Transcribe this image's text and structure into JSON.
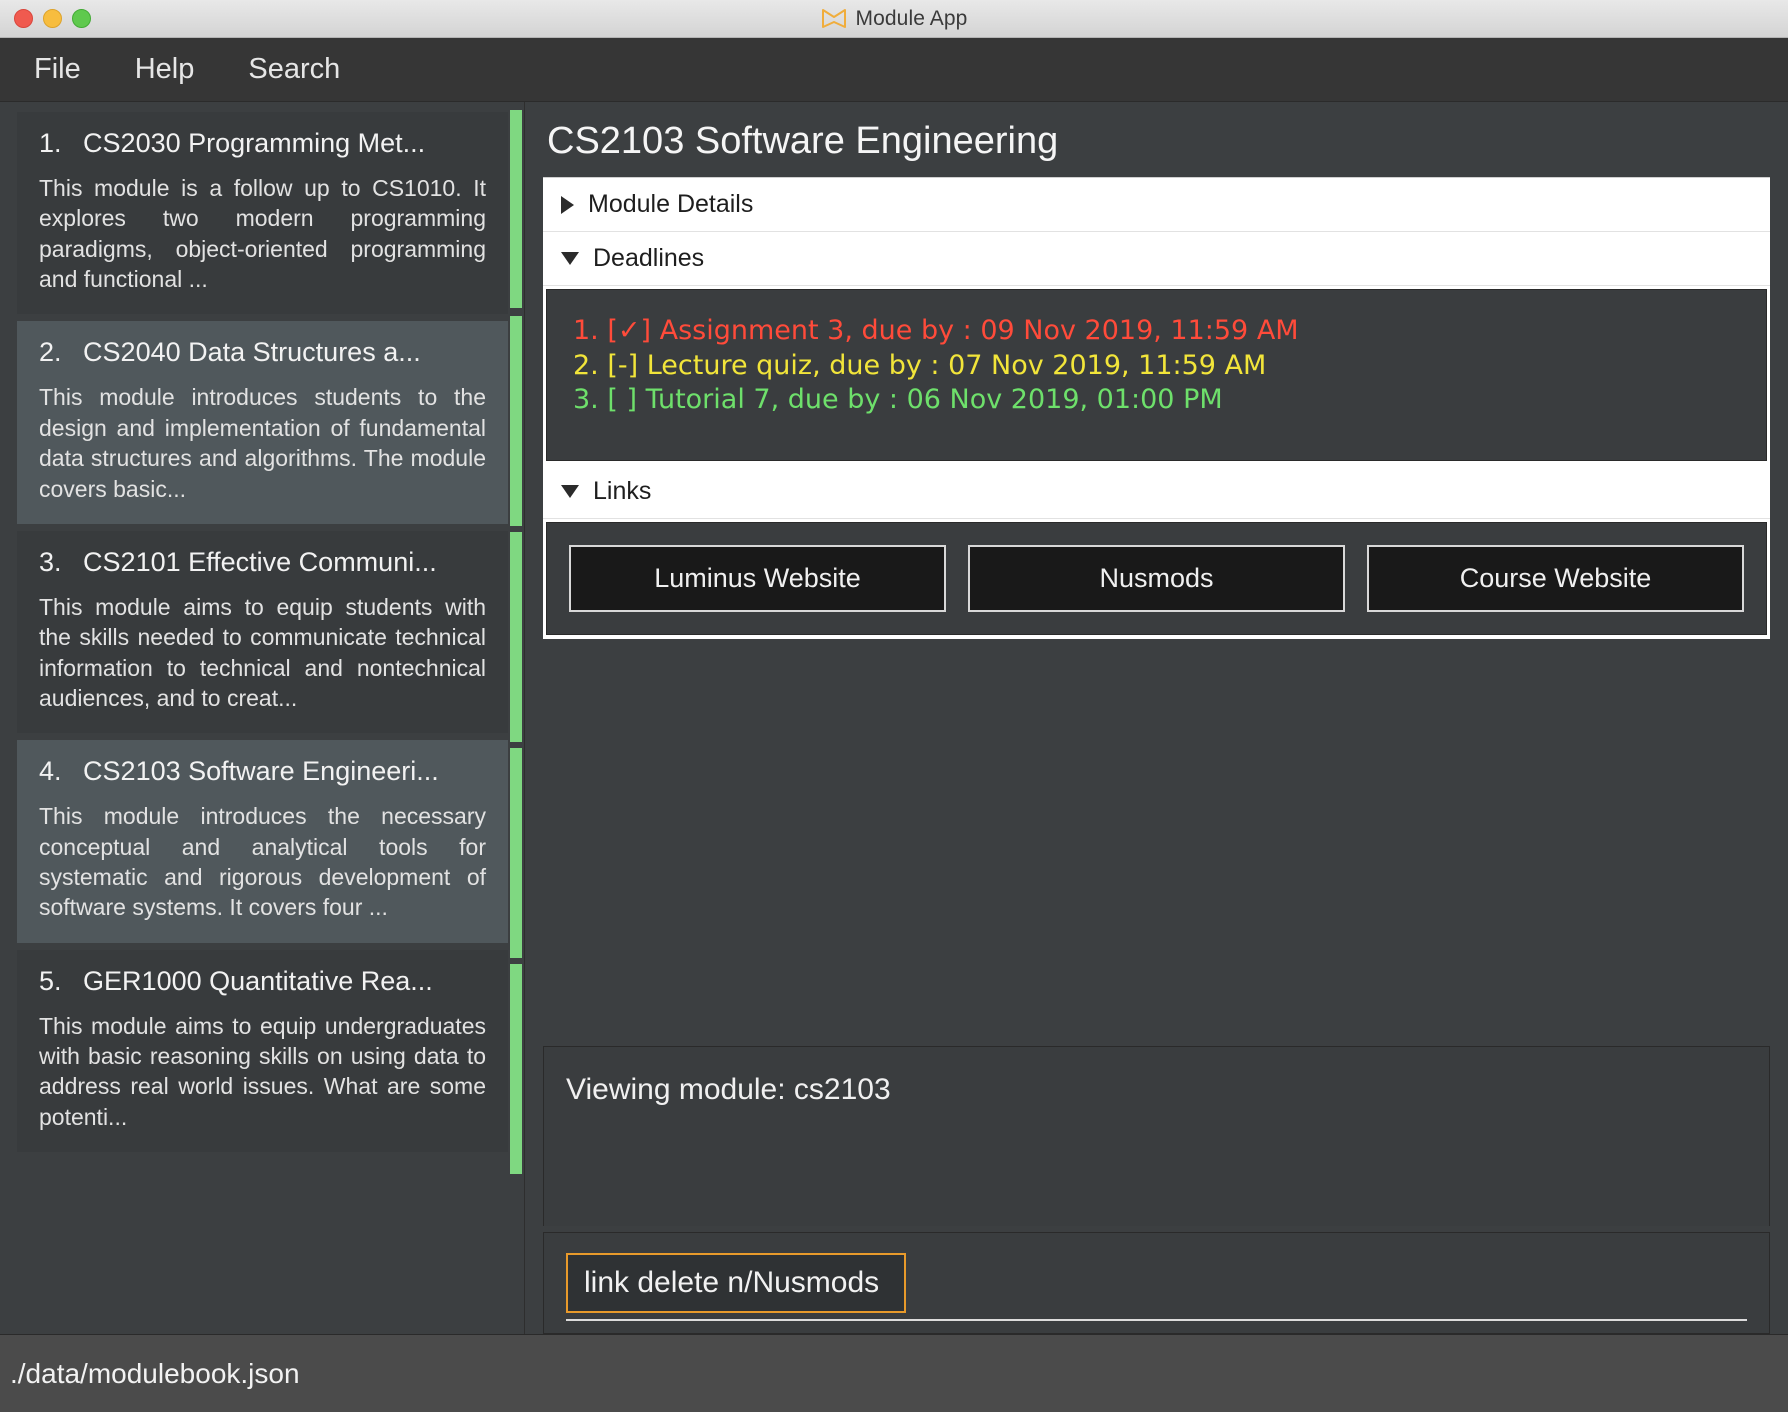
{
  "window": {
    "title": "Module App",
    "icon": "open-book-icon",
    "traffic_lights": [
      "close",
      "minimize",
      "maximize"
    ]
  },
  "menubar": {
    "items": [
      {
        "label": "File"
      },
      {
        "label": "Help"
      },
      {
        "label": "Search"
      }
    ]
  },
  "module_list": {
    "items": [
      {
        "index": "1.",
        "title": "CS2030 Programming Met...",
        "description": "This module is a follow up to CS1010. It explores two modern programming paradigms, object-oriented programming and functional ...",
        "selected": false
      },
      {
        "index": "2.",
        "title": "CS2040 Data Structures a...",
        "description": "This module introduces students to the design and implementation of fundamental data structures and algorithms. The module covers basic...",
        "selected": true
      },
      {
        "index": "3.",
        "title": "CS2101 Effective Communi...",
        "description": "This module aims to equip students with the skills needed to communicate technical information to technical and nontechnical audiences, and to creat...",
        "selected": false
      },
      {
        "index": "4.",
        "title": "CS2103 Software Engineeri...",
        "description": "This module introduces the necessary conceptual and analytical tools for systematic and rigorous development of software systems. It covers four ...",
        "selected": true
      },
      {
        "index": "5.",
        "title": "GER1000 Quantitative Rea...",
        "description": "This module aims to equip undergraduates with basic reasoning skills on using data to address real world issues. What are some potenti...",
        "selected": false
      }
    ]
  },
  "detail": {
    "heading": "CS2103 Software Engineering",
    "sections": [
      {
        "label": "Module Details",
        "expanded": false,
        "arrow": "chevron-right-icon"
      },
      {
        "label": "Deadlines",
        "expanded": true,
        "arrow": "chevron-down-icon"
      },
      {
        "label": "Links",
        "expanded": true,
        "arrow": "chevron-down-icon"
      }
    ],
    "deadlines": [
      {
        "text": "1. [✓] Assignment 3, due by : 09 Nov 2019, 11:59 AM",
        "color": "#ff4b3a"
      },
      {
        "text": "2. [-] Lecture quiz, due by : 07 Nov 2019, 11:59 AM",
        "color": "#f2e53a"
      },
      {
        "text": "3. [ ] Tutorial 7, due by : 06 Nov 2019, 01:00 PM",
        "color": "#6ee06b"
      }
    ],
    "links": [
      {
        "label": "Luminus Website"
      },
      {
        "label": "Nusmods"
      },
      {
        "label": "Course Website"
      }
    ]
  },
  "result": {
    "text": "Viewing module: cs2103"
  },
  "command": {
    "value": "link delete n/Nusmods",
    "placeholder": "Enter command here..."
  },
  "statusbar": {
    "file_path": "./data/modulebook.json"
  },
  "colors": {
    "accent_orange": "#e89a2b",
    "scrollbar_green": "#7fd881",
    "deadline_overdue": "#ff4b3a",
    "deadline_pending": "#f2e53a",
    "deadline_upcoming": "#6ee06b",
    "window_bg": "#3c3f41",
    "selected_row": "#50585c"
  }
}
